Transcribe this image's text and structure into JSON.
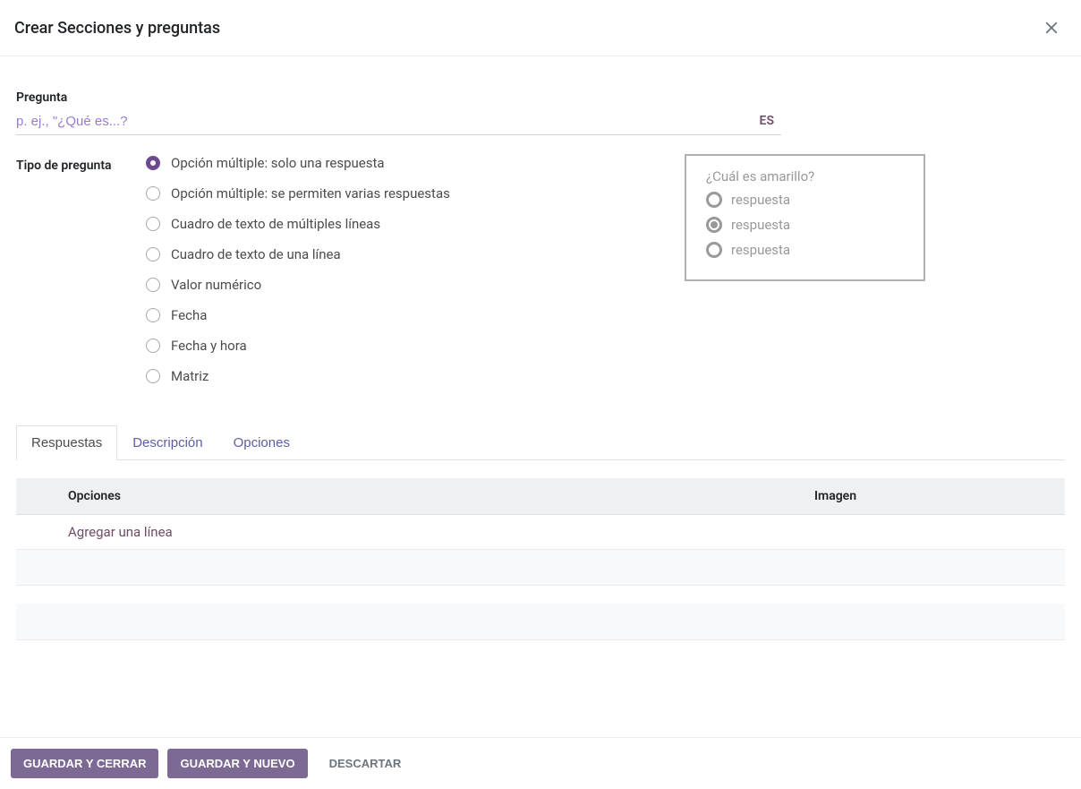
{
  "modal": {
    "title": "Crear Secciones y preguntas"
  },
  "form": {
    "question_label": "Pregunta",
    "question_placeholder": "p. ej., \"¿Qué es...?",
    "language_badge": "ES",
    "type_label": "Tipo de pregunta"
  },
  "question_types": [
    {
      "label": "Opción múltiple: solo una respuesta",
      "selected": true
    },
    {
      "label": "Opción múltiple: se permiten varias respuestas",
      "selected": false
    },
    {
      "label": "Cuadro de texto de múltiples líneas",
      "selected": false
    },
    {
      "label": "Cuadro de texto de una línea",
      "selected": false
    },
    {
      "label": "Valor numérico",
      "selected": false
    },
    {
      "label": "Fecha",
      "selected": false
    },
    {
      "label": "Fecha y hora",
      "selected": false
    },
    {
      "label": "Matriz",
      "selected": false
    }
  ],
  "preview": {
    "question": "¿Cuál es amarillo?",
    "answers": [
      {
        "label": "respuesta",
        "selected": false
      },
      {
        "label": "respuesta",
        "selected": true
      },
      {
        "label": "respuesta",
        "selected": false
      }
    ]
  },
  "tabs": [
    {
      "label": "Respuestas",
      "active": true
    },
    {
      "label": "Descripción",
      "active": false
    },
    {
      "label": "Opciones",
      "active": false
    }
  ],
  "table": {
    "columns": {
      "options": "Opciones",
      "image": "Imagen"
    },
    "add_line": "Agregar una línea"
  },
  "footer": {
    "save_close": "Guardar y Cerrar",
    "save_new": "Guardar y Nuevo",
    "discard": "Descartar"
  }
}
